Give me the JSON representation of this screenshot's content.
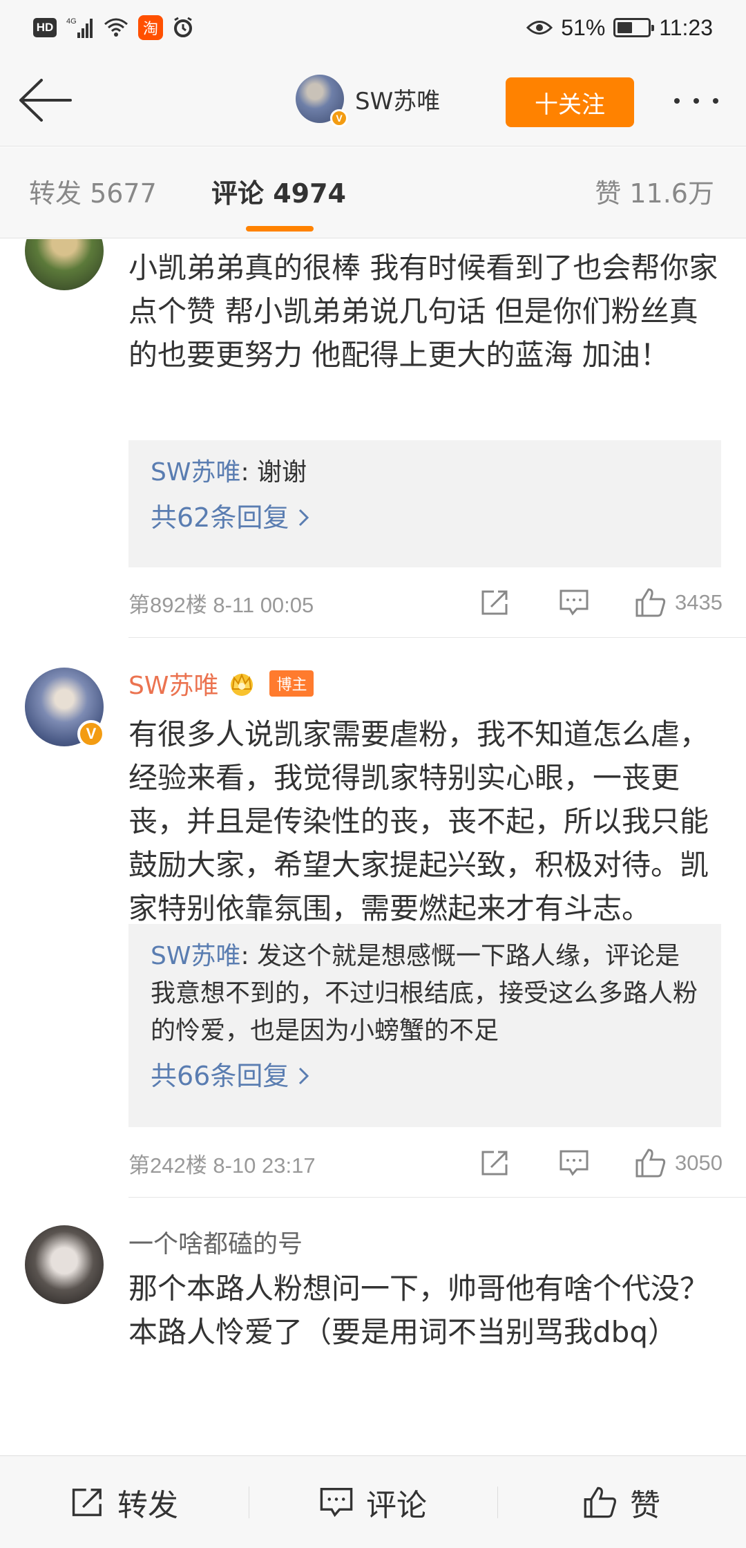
{
  "status_bar": {
    "hd": "HD",
    "network": "4G",
    "taobao": "淘",
    "battery_percent": "51%",
    "battery_level": 0.51,
    "time": "11:23"
  },
  "header": {
    "username": "SW苏唯",
    "follow_label": "十关注",
    "verified_badge": "V"
  },
  "tabs": {
    "repost": "转发 5677",
    "comments": "评论 4974",
    "likes": "赞 11.6万"
  },
  "comments": [
    {
      "author": "",
      "content": "小凯弟弟真的很棒  我有时候看到了也会帮你家点个赞  帮小凯弟弟说几句话   但是你们粉丝真的也要更努力   他配得上更大的蓝海  加油！",
      "reply": {
        "author": "SW苏唯",
        "text": ": 谢谢"
      },
      "more_replies": "共62条回复",
      "floor_time": "第892楼  8-11 00:05",
      "likes": "3435"
    },
    {
      "author": "SW苏唯",
      "tag": "博主",
      "verified_badge": "V",
      "content": "有很多人说凯家需要虐粉，我不知道怎么虐，经验来看，我觉得凯家特别实心眼，一丧更丧，并且是传染性的丧，丧不起，所以我只能鼓励大家，希望大家提起兴致，积极对待。凯家特别依靠氛围，需要燃起来才有斗志。",
      "reply": {
        "author": "SW苏唯",
        "text": ": 发这个就是想感慨一下路人缘，评论是我意想不到的，不过归根结底，接受这么多路人粉的怜爱，也是因为小螃蟹的不足"
      },
      "more_replies": "共66条回复",
      "floor_time": "第242楼  8-10 23:17",
      "likes": "3050"
    },
    {
      "author": "一个啥都磕的号",
      "content": "那个本路人粉想问一下，帅哥他有啥个代没？本路人怜爱了（要是用词不当别骂我dbq）"
    }
  ],
  "bottom_bar": {
    "repost": "转发",
    "comment": "评论",
    "like": "赞"
  },
  "colors": {
    "accent": "#ff8200",
    "author_name": "#eb7350",
    "link": "#5a7db1",
    "meta": "#999999"
  }
}
